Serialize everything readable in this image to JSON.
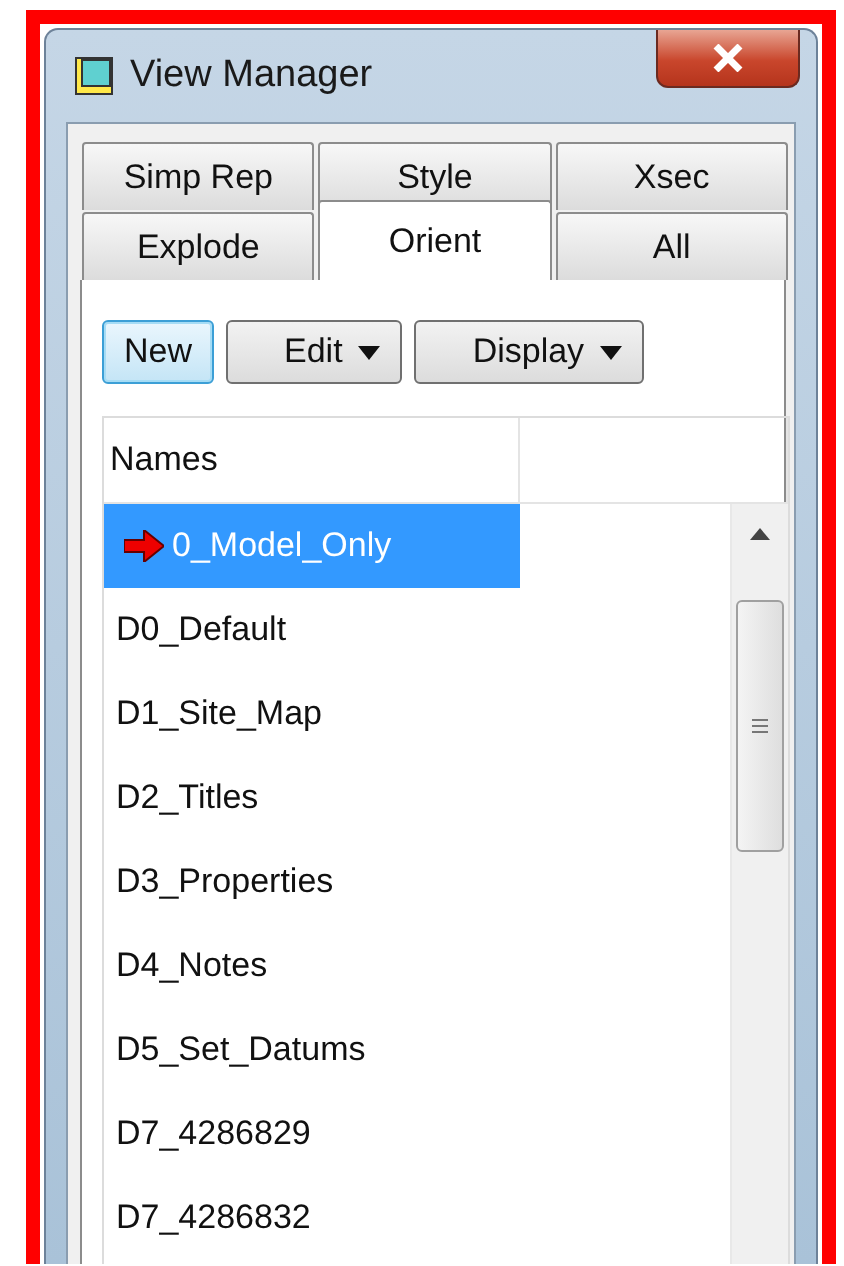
{
  "window": {
    "title": "View Manager"
  },
  "tab_rows": [
    [
      {
        "label": "Simp Rep",
        "selected": false
      },
      {
        "label": "Style",
        "selected": false
      },
      {
        "label": "Xsec",
        "selected": false
      }
    ],
    [
      {
        "label": "Explode",
        "selected": false
      },
      {
        "label": "Orient",
        "selected": true
      },
      {
        "label": "All",
        "selected": false
      }
    ]
  ],
  "buttons": [
    {
      "label": "New",
      "kind": "plain",
      "focused": true
    },
    {
      "label": "Edit",
      "kind": "menu",
      "focused": false
    },
    {
      "label": "Display",
      "kind": "menu",
      "focused": false
    }
  ],
  "list": {
    "columns": [
      "Names"
    ],
    "rows": [
      {
        "name": "0_Model_Only",
        "selected": true,
        "active": true
      },
      {
        "name": "D0_Default",
        "selected": false,
        "active": false
      },
      {
        "name": "D1_Site_Map",
        "selected": false,
        "active": false
      },
      {
        "name": "D2_Titles",
        "selected": false,
        "active": false
      },
      {
        "name": "D3_Properties",
        "selected": false,
        "active": false
      },
      {
        "name": "D4_Notes",
        "selected": false,
        "active": false
      },
      {
        "name": "D5_Set_Datums",
        "selected": false,
        "active": false
      },
      {
        "name": "D7_4286829",
        "selected": false,
        "active": false
      },
      {
        "name": "D7_4286832",
        "selected": false,
        "active": false
      }
    ]
  }
}
